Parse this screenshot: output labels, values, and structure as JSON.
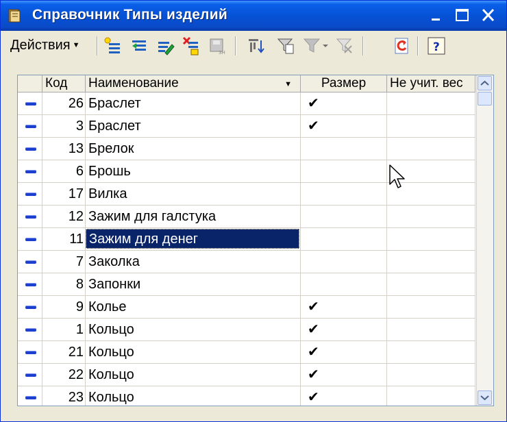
{
  "window": {
    "title": "Справочник Типы изделий"
  },
  "toolbar": {
    "actions_label": "Действия"
  },
  "table": {
    "columns": {
      "code": "Код",
      "name": "Наименование",
      "size": "Размер",
      "weight": "Не учит. вес"
    },
    "rows": [
      {
        "code": "26",
        "name": "Браслет",
        "size": "✔",
        "weight": ""
      },
      {
        "code": "3",
        "name": "Браслет",
        "size": "✔",
        "weight": ""
      },
      {
        "code": "13",
        "name": "Брелок",
        "size": "",
        "weight": ""
      },
      {
        "code": "6",
        "name": "Брошь",
        "size": "",
        "weight": ""
      },
      {
        "code": "17",
        "name": "Вилка",
        "size": "",
        "weight": ""
      },
      {
        "code": "12",
        "name": "Зажим для галстука",
        "size": "",
        "weight": ""
      },
      {
        "code": "11",
        "name": "Зажим для денег",
        "size": "",
        "weight": ""
      },
      {
        "code": "7",
        "name": "Заколка",
        "size": "",
        "weight": ""
      },
      {
        "code": "8",
        "name": "Запонки",
        "size": "",
        "weight": ""
      },
      {
        "code": "9",
        "name": "Колье",
        "size": "✔",
        "weight": ""
      },
      {
        "code": "1",
        "name": "Кольцо",
        "size": "✔",
        "weight": ""
      },
      {
        "code": "21",
        "name": "Кольцо",
        "size": "✔",
        "weight": ""
      },
      {
        "code": "22",
        "name": "Кольцо",
        "size": "✔",
        "weight": ""
      },
      {
        "code": "23",
        "name": "Кольцо",
        "size": "✔",
        "weight": ""
      }
    ]
  },
  "colors": {
    "titlebar": "#0652d6",
    "selection": "#0a246a",
    "row_icon": "#1c3fd0"
  }
}
